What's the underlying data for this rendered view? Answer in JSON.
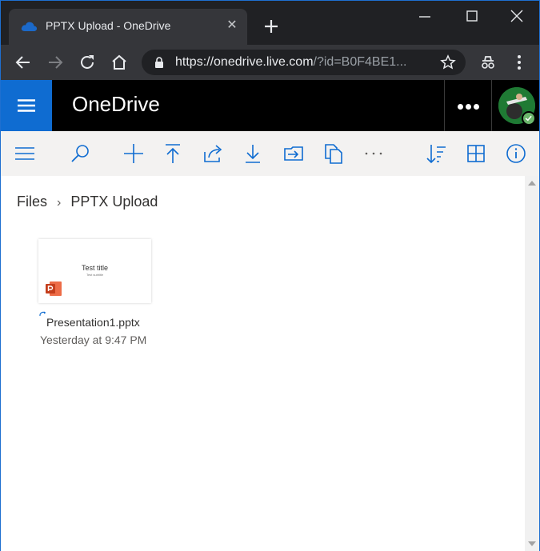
{
  "browser": {
    "tab_title": "PPTX Upload - OneDrive",
    "tab_close": "✕",
    "url_host": "https://onedrive.live.com",
    "url_rest": "/?id=B0F4BE1...",
    "icons": [
      "onedrive-cloud-icon",
      "close-icon",
      "plus-icon",
      "minimize-icon",
      "maximize-icon",
      "window-close-icon",
      "back-arrow-icon",
      "forward-arrow-icon",
      "reload-icon",
      "home-icon",
      "lock-icon",
      "star-icon",
      "incognito-icon",
      "kebab-menu-icon"
    ]
  },
  "header": {
    "brand": "OneDrive",
    "accent_color": "#0f6cd1"
  },
  "commandbar": {
    "icons": [
      "hamburger-icon",
      "search-icon",
      "new-icon",
      "upload-icon",
      "share-icon",
      "download-icon",
      "move-to-icon",
      "copy-to-icon",
      "more-icon",
      "sort-icon",
      "view-grid-icon",
      "info-icon"
    ]
  },
  "breadcrumb": {
    "root": "Files",
    "separator": "›",
    "current": "PPTX Upload"
  },
  "files": [
    {
      "name": "Presentation1.pptx",
      "modified": "Yesterday at 9:47 PM",
      "thumbnail_title": "Test title",
      "thumbnail_subtitle": "Test subtitle"
    }
  ]
}
